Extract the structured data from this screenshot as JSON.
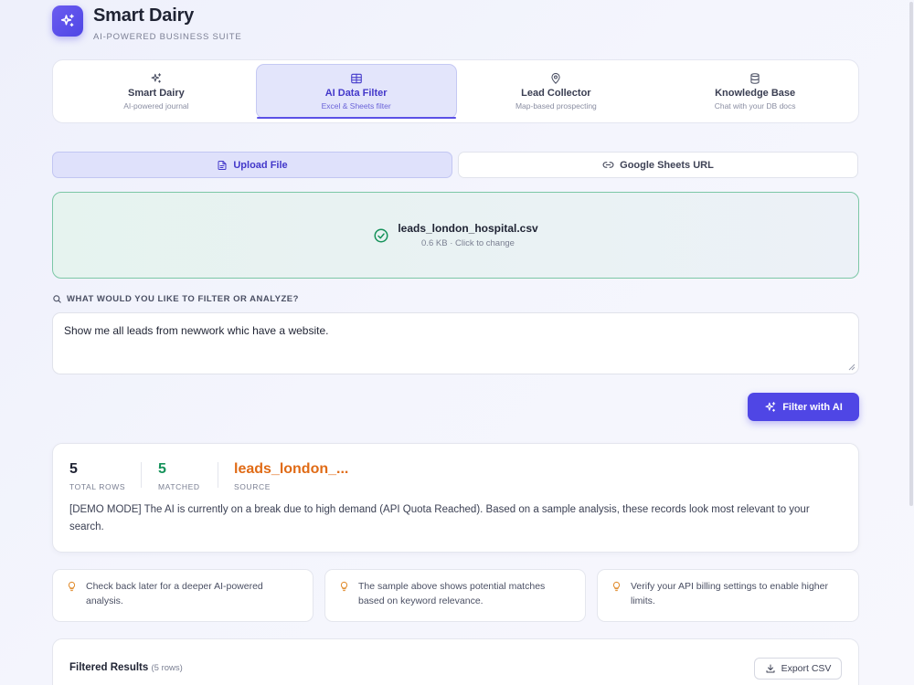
{
  "brand": {
    "title": "Smart Dairy",
    "subtitle": "AI-POWERED BUSINESS SUITE",
    "logo_icon": "sparkles-icon"
  },
  "tabs": [
    {
      "label": "Smart Dairy",
      "desc": "AI-powered journal",
      "icon": "sparkles-icon",
      "active": false
    },
    {
      "label": "AI Data Filter",
      "desc": "Excel & Sheets filter",
      "icon": "table-icon",
      "active": true
    },
    {
      "label": "Lead Collector",
      "desc": "Map-based prospecting",
      "icon": "map-pin-icon",
      "active": false
    },
    {
      "label": "Knowledge Base",
      "desc": "Chat with your DB docs",
      "icon": "database-icon",
      "active": false
    }
  ],
  "source": {
    "upload_label": "Upload File",
    "sheets_label": "Google Sheets URL",
    "selected": "Upload File"
  },
  "file": {
    "name": "leads_london_hospital.csv",
    "meta": "0.6 KB · Click to change"
  },
  "query": {
    "label": "WHAT WOULD YOU LIKE TO FILTER OR ANALYZE?",
    "value": "Show me all leads from newwork whic have a website."
  },
  "filter_button": "Filter with AI",
  "stats": {
    "total_rows": "5",
    "total_rows_label": "TOTAL ROWS",
    "matched": "5",
    "matched_label": "MATCHED",
    "source": "leads_london_...",
    "source_label": "SOURCE",
    "message": "[DEMO MODE] The AI is currently on a break due to high demand (API Quota Reached). Based on a sample analysis, these records look most relevant to your search."
  },
  "tips": [
    "Check back later for a deeper AI-powered analysis.",
    "The sample above shows potential matches based on keyword relevance.",
    "Verify your API billing settings to enable higher limits."
  ],
  "results": {
    "title": "Filtered Results",
    "count": "(5 rows)",
    "export_label": "Export CSV"
  },
  "colors": {
    "accent": "#4f46e5",
    "matched": "#15925a",
    "source": "#e06b16",
    "file_border": "#7cc7a6",
    "tip_icon": "#e08a2a"
  }
}
